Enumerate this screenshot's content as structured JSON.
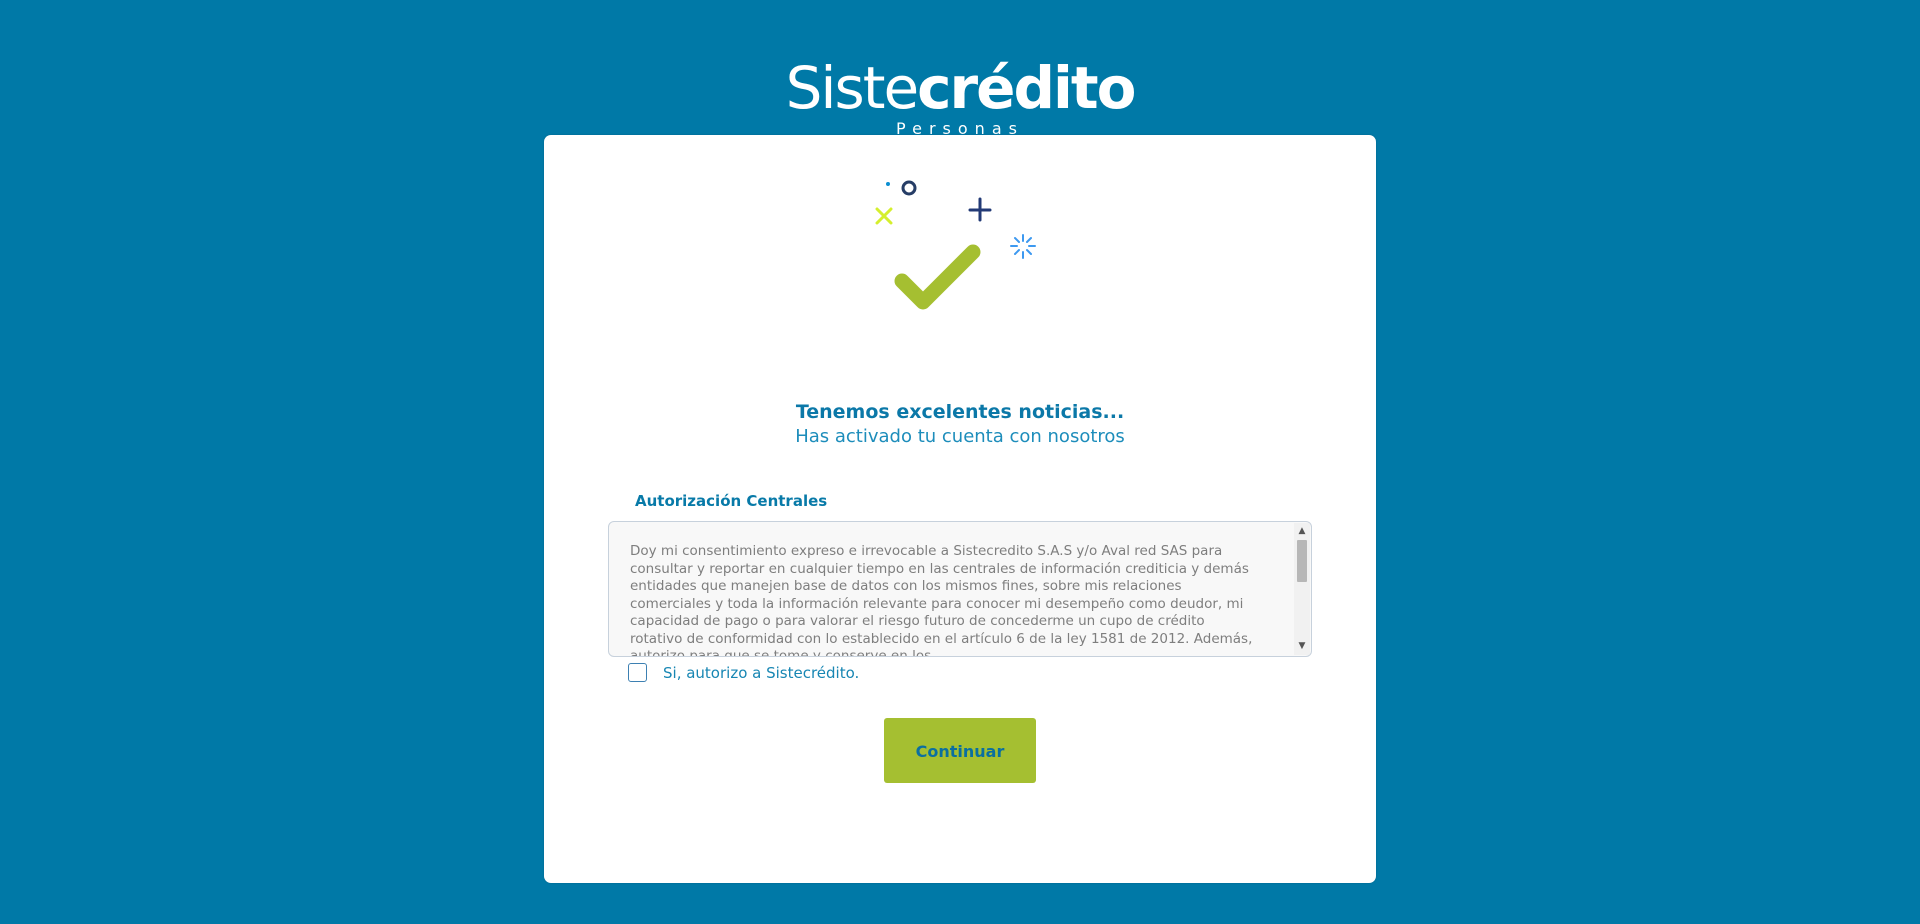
{
  "brand": {
    "logo_light": "Siste",
    "logo_bold": "crédito",
    "logo_subtitle": "Personas"
  },
  "success": {
    "title": "Tenemos excelentes noticias...",
    "subtitle": "Has activado tu cuenta con nosotros"
  },
  "authorization": {
    "title": "Autorización Centrales",
    "text": "Doy mi consentimiento expreso e irrevocable a Sistecredito S.A.S y/o Aval red SAS para consultar y reportar en cualquier tiempo en las centrales de información crediticia y demás entidades que manejen base de datos con los mismos fines, sobre mis relaciones comerciales y toda la información relevante para conocer mi desempeño como deudor, mi capacidad de pago o para valorar el riesgo futuro de concederme un cupo de crédito rotativo de conformidad con lo establecido en el artículo 6 de la ley 1581 de 2012. Además, autorizo para que se tome y conserve en los",
    "checkbox_label": "Si, autorizo a Sistecrédito."
  },
  "actions": {
    "continue_label": "Continuar"
  },
  "colors": {
    "background": "#0079a7",
    "accent": "#a5bf31",
    "primary_text": "#0b78a8"
  },
  "icons": {
    "success": "success-check-icon",
    "scroll_up": "scroll-up-arrow-icon",
    "scroll_down": "scroll-down-arrow-icon"
  }
}
